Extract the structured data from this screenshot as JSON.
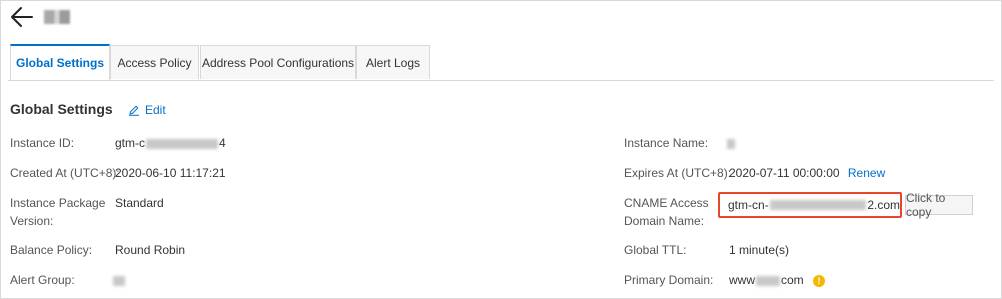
{
  "header": {
    "back_icon": "arrow-left-icon",
    "title_masked": true
  },
  "tabs": [
    {
      "label": "Global Settings",
      "active": true
    },
    {
      "label": "Access Policy",
      "active": false
    },
    {
      "label": "Address Pool Configurations",
      "active": false
    },
    {
      "label": "Alert Logs",
      "active": false
    }
  ],
  "section": {
    "title": "Global Settings",
    "edit_label": "Edit",
    "edit_icon": "pencil-icon"
  },
  "fields": {
    "instance_id_label": "Instance ID:",
    "instance_id_prefix": "gtm-c",
    "instance_id_suffix": "4",
    "created_at_label": "Created At (UTC+8):",
    "created_at_value": "2020-06-10 11:17:21",
    "package_label_line1": "Instance Package",
    "package_label_line2": "Version:",
    "package_value": "Standard",
    "balance_label": "Balance Policy:",
    "balance_value": "Round Robin",
    "alert_group_label": "Alert Group:",
    "instance_name_label": "Instance Name:",
    "expires_label": "Expires At (UTC+8):",
    "expires_value": "2020-07-11 00:00:00",
    "renew_label": "Renew",
    "cname_label_line1": "CNAME Access",
    "cname_label_line2": "Domain Name:",
    "cname_prefix": "gtm-cn-",
    "cname_suffix": "2.com",
    "copy_label": "Click to copy",
    "ttl_label": "Global TTL:",
    "ttl_value": "1 minute(s)",
    "primary_domain_label": "Primary Domain:",
    "primary_domain_prefix": "www",
    "primary_domain_suffix": "com",
    "warning_icon": "warning-icon"
  },
  "colors": {
    "accent": "#0070cc",
    "highlight_border": "#e8452c",
    "warning": "#f5b800"
  }
}
